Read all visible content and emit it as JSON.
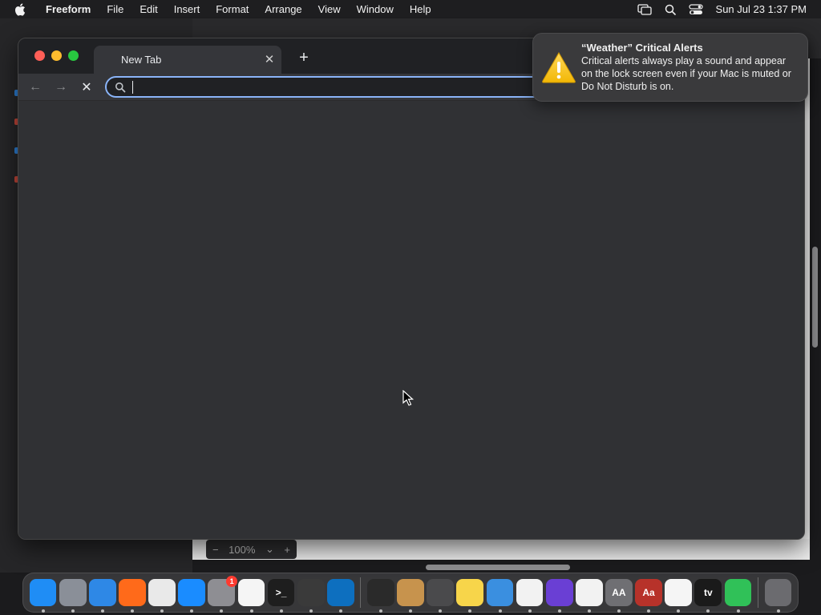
{
  "menubar": {
    "app_name": "Freeform",
    "items": [
      "File",
      "Edit",
      "Insert",
      "Format",
      "Arrange",
      "View",
      "Window",
      "Help"
    ],
    "clock": "Sun Jul 23  1:37 PM",
    "icons": [
      "display-icon",
      "search-icon",
      "control-center-icon"
    ]
  },
  "browser": {
    "tab_title": "New Tab",
    "tab_close_glyph": "✕",
    "new_tab_glyph": "+",
    "back_glyph": "←",
    "forward_glyph": "→",
    "stop_glyph": "✕",
    "address_value": "",
    "address_placeholder": ""
  },
  "notification": {
    "title": "“Weather” Critical Alerts",
    "body": "Critical alerts always play a sound and appear on the lock screen even if your Mac is muted or Do Not Disturb is on."
  },
  "freeform": {
    "zoom_level": "100%",
    "zoom_out_glyph": "−",
    "zoom_in_glyph": "+",
    "zoom_menu_glyph": "⌄"
  },
  "dock": {
    "apps": [
      {
        "name": "finder",
        "color": "#1f8df5",
        "label": ""
      },
      {
        "name": "launchpad",
        "color": "#8a8f98",
        "label": ""
      },
      {
        "name": "safari",
        "color": "#2e88e6",
        "label": ""
      },
      {
        "name": "firefox",
        "color": "#ff6a1a",
        "label": ""
      },
      {
        "name": "chrome",
        "color": "#e9e9e9",
        "label": ""
      },
      {
        "name": "app-store",
        "color": "#1a8cff",
        "label": ""
      },
      {
        "name": "system-settings",
        "color": "#8e8e93",
        "label": "",
        "badge": "1"
      },
      {
        "name": "textedit",
        "color": "#f5f5f5",
        "label": ""
      },
      {
        "name": "terminal",
        "color": "#1e1e1e",
        "label": ">_"
      },
      {
        "name": "garageband",
        "color": "#3a3a3a",
        "label": ""
      },
      {
        "name": "vscode",
        "color": "#0d6fbf",
        "label": ""
      },
      {
        "name": "voice-memos",
        "color": "#2a2a2a",
        "label": ""
      },
      {
        "name": "contacts",
        "color": "#c7934d",
        "label": ""
      },
      {
        "name": "screenshot",
        "color": "#4a4a4c",
        "label": ""
      },
      {
        "name": "notes",
        "color": "#f7d54a",
        "label": ""
      },
      {
        "name": "weather",
        "color": "#3a8fe0",
        "label": ""
      },
      {
        "name": "reminders",
        "color": "#f2f2f2",
        "label": ""
      },
      {
        "name": "shortcuts",
        "color": "#6a3fd4",
        "label": ""
      },
      {
        "name": "news",
        "color": "#f2f2f2",
        "label": ""
      },
      {
        "name": "font-book",
        "color": "#6f6f73",
        "label": "AA"
      },
      {
        "name": "dictionary",
        "color": "#b7322a",
        "label": "Aa"
      },
      {
        "name": "freeform",
        "color": "#f5f5f5",
        "label": ""
      },
      {
        "name": "apple-tv",
        "color": "#1a1a1a",
        "label": "tv"
      },
      {
        "name": "find-my",
        "color": "#30c158",
        "label": ""
      },
      {
        "name": "trash",
        "color": "#6b6b6f",
        "label": ""
      }
    ]
  }
}
